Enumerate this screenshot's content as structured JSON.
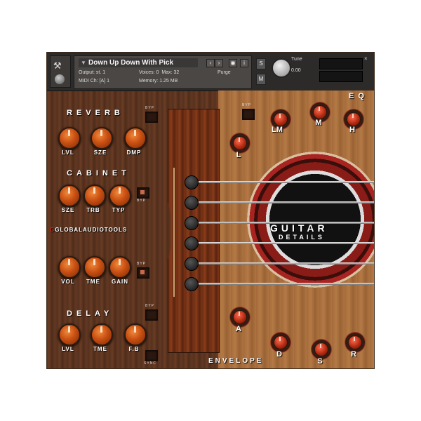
{
  "header": {
    "instrument_name": "Down Up Down With Pick",
    "output_label": "Output:",
    "output_value": "st. 1",
    "voices_label": "Voices:",
    "voices_value": "0",
    "max_label": "Max:",
    "max_value": "32",
    "purge_label": "Purge",
    "midi_label": "MIDI Ch:",
    "midi_value": "[A] 1",
    "memory_label": "Memory:",
    "memory_value": "1.25 MB",
    "tune_label": "Tune",
    "tune_value": "0.00",
    "s_label": "S",
    "m_label": "M",
    "close_label": "×"
  },
  "reverb": {
    "title": "REVERB",
    "bypass_label": "BYP",
    "knobs": [
      "LVL",
      "SZE",
      "DMP"
    ]
  },
  "cabinet": {
    "title": "CABINET",
    "bypass_label": "BYP",
    "knobs": [
      "SZE",
      "TRB",
      "TYP"
    ]
  },
  "brand": {
    "mark": "G",
    "text": "GLOBALAUDIOTOOLS"
  },
  "amp": {
    "bypass_label": "BYP",
    "knobs": [
      "VOL",
      "TME",
      "GAIN"
    ]
  },
  "delay": {
    "title": "DELAY",
    "bypass_label": "BYP",
    "sync_label": "SYNC",
    "knobs": [
      "LVL",
      "TME",
      "F.B"
    ]
  },
  "eq": {
    "title": "EQ",
    "bypass_label": "BYP",
    "knobs": [
      "L",
      "LM",
      "M",
      "H"
    ]
  },
  "guitar": {
    "title": "GUITAR",
    "subtitle": "DETAILS"
  },
  "envelope": {
    "title": "ENVELOPE",
    "knobs": [
      "A",
      "D",
      "S",
      "R"
    ]
  }
}
